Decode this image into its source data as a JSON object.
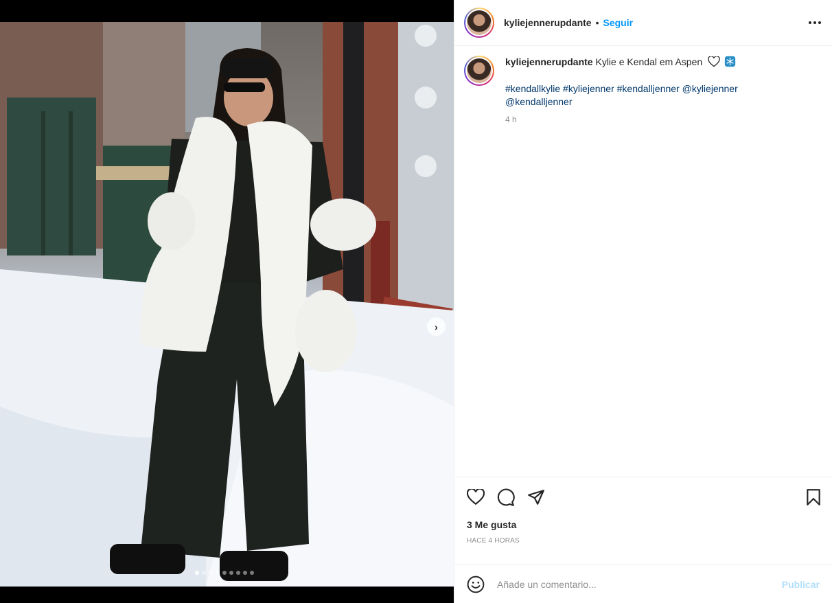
{
  "post": {
    "username": "kyliejennerupdante",
    "follow_label": "Seguir",
    "separator": "•"
  },
  "caption": {
    "username": "kyliejennerupdante",
    "text": "Kylie e Kendal em Aspen",
    "emojis": [
      "heart-outline",
      "snowflake"
    ],
    "tags_line1": "#kendallkylie #kyliejenner #kendalljenner @kyliejenner",
    "tags_line2": "@kendalljenner",
    "time": "4 h"
  },
  "stats": {
    "likes": "3 Me gusta",
    "posted_ago": "HACE 4 HORAS"
  },
  "comment": {
    "placeholder": "Añade un comentario...",
    "publish_label": "Publicar"
  },
  "carousel": {
    "total_slides": 9,
    "active_index": 0
  },
  "icons": {
    "like": "heart-icon",
    "comment": "comment-bubble-icon",
    "share": "paper-plane-icon",
    "save": "bookmark-icon",
    "more": "more-options-icon",
    "emoji": "emoji-smile-icon",
    "next": "chevron-right-icon"
  },
  "colors": {
    "follow": "#0095f6",
    "hashtag": "#00376b",
    "publish_disabled": "#b2dffc",
    "muted": "#8e8e8e"
  }
}
